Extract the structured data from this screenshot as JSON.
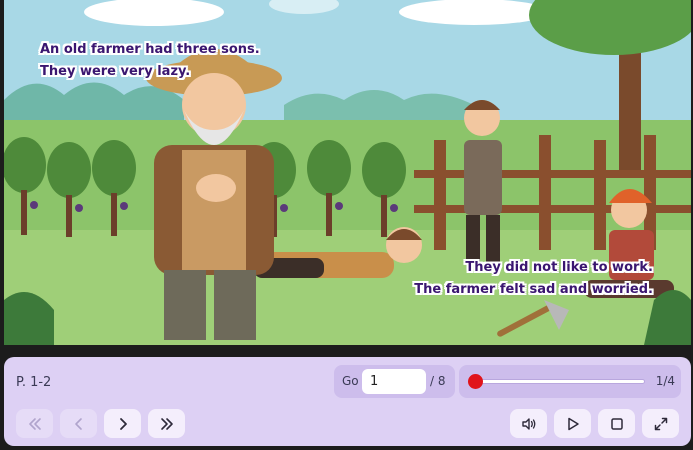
{
  "story": {
    "caption_top": [
      "An old farmer had three sons.",
      "They were very lazy."
    ],
    "caption_bottom": [
      "They did not like to work.",
      "The farmer felt sad and worried."
    ]
  },
  "controls": {
    "page_indicator": "P. 1-2",
    "goto_label": "Go",
    "page_input_value": "1",
    "page_total": "/ 8",
    "progress_count": "1/4",
    "progress_fraction": 0
  },
  "icons": {
    "first": "double-chevron-left-icon",
    "prev": "chevron-left-icon",
    "next": "chevron-right-icon",
    "last": "double-chevron-right-icon",
    "audio": "speaker-wave-icon",
    "play": "play-icon",
    "stop": "stop-icon",
    "fullscreen": "expand-arrows-icon"
  },
  "colors": {
    "caption_text": "#3a1670",
    "control_bar": "#ddd0f4",
    "progress_thumb": "#e0141b"
  }
}
